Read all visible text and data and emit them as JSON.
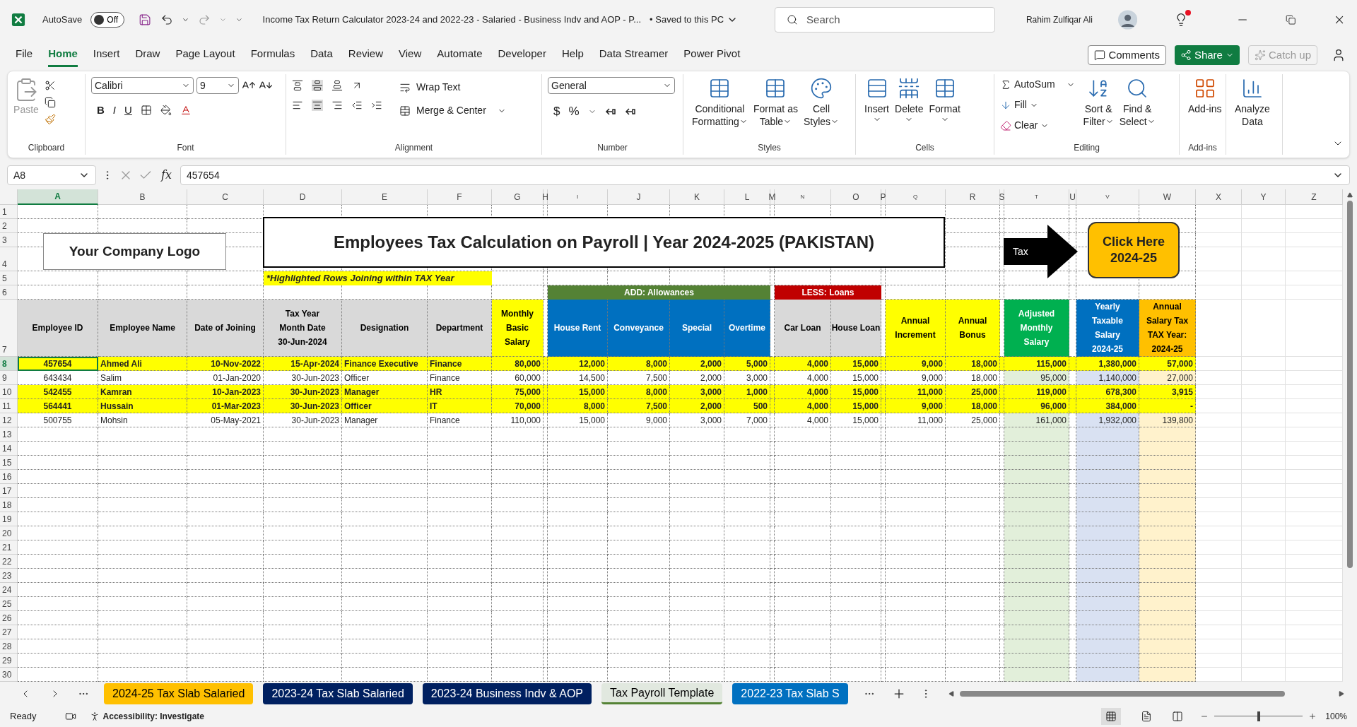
{
  "title_bar": {
    "autosave_label": "AutoSave",
    "autosave_state": "Off",
    "autosave_on": false,
    "document_title": "Income Tax Return Calculator 2023-24 and 2022-23 - Salaried - Business Indv and AOP - P...",
    "save_status": "• Saved to this PC",
    "search_placeholder": "Search",
    "user_name": "Rahim Zulfiqar Ali"
  },
  "menu_tabs": [
    {
      "label": "File",
      "selected": false
    },
    {
      "label": "Home",
      "selected": true
    },
    {
      "label": "Insert",
      "selected": false
    },
    {
      "label": "Draw",
      "selected": false
    },
    {
      "label": "Page Layout",
      "selected": false
    },
    {
      "label": "Formulas",
      "selected": false
    },
    {
      "label": "Data",
      "selected": false
    },
    {
      "label": "Review",
      "selected": false
    },
    {
      "label": "View",
      "selected": false
    },
    {
      "label": "Automate",
      "selected": false
    },
    {
      "label": "Developer",
      "selected": false
    },
    {
      "label": "Help",
      "selected": false
    },
    {
      "label": "Data Streamer",
      "selected": false
    },
    {
      "label": "Power Pivot",
      "selected": false
    }
  ],
  "menu_actions": {
    "comments": "Comments",
    "share": "Share",
    "catch_up": "Catch up"
  },
  "ribbon": {
    "clipboard": {
      "label": "Clipboard",
      "paste": "Paste"
    },
    "font": {
      "label": "Font",
      "name": "Calibri",
      "size": "9",
      "bold": "B",
      "italic": "I",
      "underline": "U"
    },
    "alignment": {
      "label": "Alignment",
      "wrap": "Wrap Text",
      "merge": "Merge & Center"
    },
    "number": {
      "label": "Number",
      "format": "General",
      "currency": "$",
      "percent": "%"
    },
    "styles": {
      "label": "Styles",
      "buttons": [
        {
          "line1": "Conditional",
          "line2": "Formatting"
        },
        {
          "line1": "Format as",
          "line2": "Table"
        },
        {
          "line1": "Cell",
          "line2": "Styles"
        }
      ]
    },
    "cells": {
      "label": "Cells",
      "buttons": [
        "Insert",
        "Delete",
        "Format"
      ]
    },
    "editing": {
      "label": "Editing",
      "autosum": "AutoSum",
      "fill": "Fill",
      "clear": "Clear",
      "sort": {
        "line1": "Sort &",
        "line2": "Filter"
      },
      "find": {
        "line1": "Find &",
        "line2": "Select"
      }
    },
    "addins": {
      "label": "Add-ins",
      "button": "Add-ins"
    },
    "analyze": {
      "line1": "Analyze",
      "line2": "Data"
    }
  },
  "formula_bar": {
    "name_box": "A8",
    "fx": "fx",
    "value": "457654"
  },
  "columns": [
    "A",
    "B",
    "C",
    "D",
    "E",
    "F",
    "G",
    "H",
    "I",
    "J",
    "K",
    "L",
    "M",
    "N",
    "O",
    "P",
    "Q",
    "R",
    "S",
    "T",
    "U",
    "V",
    "W",
    "X",
    "Y",
    "Z"
  ],
  "row_numbers": [
    "1",
    "2",
    "3",
    "4",
    "5",
    "6",
    "7",
    "8",
    "9",
    "10",
    "11",
    "12",
    "13",
    "14",
    "15",
    "16",
    "17",
    "18",
    "19",
    "20",
    "21",
    "22",
    "23",
    "24",
    "25",
    "26",
    "27",
    "28",
    "29",
    "30"
  ],
  "sheet": {
    "logo": "Your Company Logo",
    "title": "Employees Tax Calculation on Payroll | Year 2024-2025 (PAKISTAN)",
    "note": "*Highlighted Rows Joining within TAX Year",
    "arrow_label": "Tax",
    "button": {
      "line1": "Click Here",
      "line2": "2024-25"
    }
  },
  "group_headers": [
    {
      "label": "ADD: Allowances",
      "color": "#548235"
    },
    {
      "label": "LESS: Loans",
      "color": "#c00000"
    }
  ],
  "headers": [
    {
      "label": "Employee ID",
      "color": "#d9d9d9"
    },
    {
      "label": "Employee Name",
      "color": "#d9d9d9"
    },
    {
      "label": "Date of Joining",
      "color": "#d9d9d9"
    },
    {
      "label": "Tax Year\nMonth Date\n30-Jun-2024",
      "color": "#d9d9d9"
    },
    {
      "label": "Designation",
      "color": "#d9d9d9"
    },
    {
      "label": "Department",
      "color": "#d9d9d9"
    },
    {
      "label": "Monthly\nBasic\nSalary",
      "color": "#ffff00"
    },
    {
      "label": "House Rent",
      "color": "#0070c0"
    },
    {
      "label": "Conveyance",
      "color": "#0070c0"
    },
    {
      "label": "Special",
      "color": "#0070c0"
    },
    {
      "label": "Overtime",
      "color": "#0070c0"
    },
    {
      "label": "Car Loan",
      "color": "#d9d9d9"
    },
    {
      "label": "House Loan",
      "color": "#d9d9d9"
    },
    {
      "label": "Annual\nIncrement",
      "color": "#ffff00"
    },
    {
      "label": "Annual\nBonus",
      "color": "#ffff00"
    },
    {
      "label": "Adjusted\nMonthly\nSalary",
      "color": "#00b050",
      "column": {
        "color": "#e2efda"
      }
    },
    {
      "label": "Yearly\nTaxable\nSalary\n2024-25",
      "color": "#0070c0",
      "column": {
        "color": "#d9e1f2"
      }
    },
    {
      "label": "Annual\nSalary Tax\nTAX Year:\n2024-25",
      "color": "#ffc000",
      "column": {
        "color": "#fff2cc"
      }
    }
  ],
  "data_rows": [
    {
      "highlighted": true,
      "active_cell": true,
      "cells": [
        "457654",
        "Ahmed Ali",
        "10-Nov-2022",
        "15-Apr-2024",
        "Finance Executive",
        "Finance",
        "80,000",
        "12,000",
        "8,000",
        "2,000",
        "5,000",
        "4,000",
        "15,000",
        "9,000",
        "18,000",
        "115,000",
        "1,380,000",
        "57,000"
      ]
    },
    {
      "highlighted": false,
      "active_cell": false,
      "cells": [
        "643434",
        "Salim",
        "01-Jan-2020",
        "30-Jun-2023",
        "Officer",
        "Finance",
        "60,000",
        "14,500",
        "7,500",
        "2,000",
        "3,000",
        "4,000",
        "15,000",
        "9,000",
        "18,000",
        "95,000",
        "1,140,000",
        "27,000"
      ]
    },
    {
      "highlighted": true,
      "active_cell": false,
      "cells": [
        "542455",
        "Kamran",
        "10-Jan-2023",
        "30-Jun-2023",
        "Manager",
        "HR",
        "75,000",
        "15,000",
        "8,000",
        "3,000",
        "1,000",
        "4,000",
        "15,000",
        "11,000",
        "25,000",
        "119,000",
        "678,300",
        "3,915"
      ]
    },
    {
      "highlighted": true,
      "active_cell": false,
      "cells": [
        "564441",
        "Hussain",
        "01-Mar-2023",
        "30-Jun-2023",
        "Officer",
        "IT",
        "70,000",
        "8,000",
        "7,500",
        "2,000",
        "500",
        "4,000",
        "15,000",
        "9,000",
        "18,000",
        "96,000",
        "384,000",
        "-"
      ]
    },
    {
      "highlighted": false,
      "active_cell": false,
      "cells": [
        "500755",
        "Mohsin",
        "05-May-2021",
        "30-Jun-2023",
        "Manager",
        "Finance",
        "110,000",
        "15,000",
        "9,000",
        "3,000",
        "7,000",
        "4,000",
        "15,000",
        "11,000",
        "25,000",
        "161,000",
        "1,932,000",
        "139,800"
      ]
    }
  ],
  "sheet_tabs": [
    {
      "label": "2024-25 Tax Slab Salaried",
      "color": "#ffc000",
      "selected": false
    },
    {
      "label": "2023-24 Tax Slab Salaried",
      "color": "#002060",
      "selected": false
    },
    {
      "label": "2023-24 Business Indv & AOP",
      "color": "#002060",
      "selected": false
    },
    {
      "label": "Tax Payroll Template",
      "color": "#548235",
      "selected": true
    },
    {
      "label": "2022-23 Tax Slab S",
      "color": "#0070c0",
      "selected": false
    }
  ],
  "status_bar": {
    "ready": "Ready",
    "accessibility": "Accessibility: Investigate",
    "zoom": "100%",
    "zoom_slider": {
      "level": 0.5
    }
  }
}
